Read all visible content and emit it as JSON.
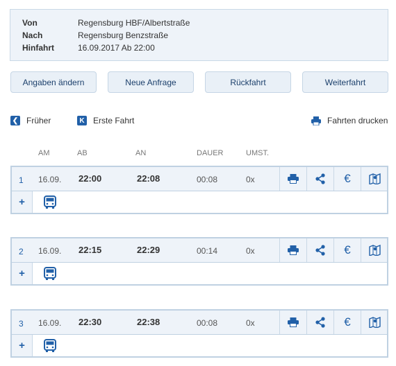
{
  "summary": {
    "von_label": "Von",
    "von_value": "Regensburg HBF/Albertstraße",
    "nach_label": "Nach",
    "nach_value": "Regensburg Benzstraße",
    "hinfahrt_label": "Hinfahrt",
    "hinfahrt_value": "16.09.2017 Ab 22:00"
  },
  "buttons": {
    "edit": "Angaben ändern",
    "new": "Neue Anfrage",
    "return": "Rückfahrt",
    "onward": "Weiterfahrt"
  },
  "nav": {
    "earlier": "Früher",
    "first": "Erste Fahrt",
    "print_all": "Fahrten drucken"
  },
  "columns": {
    "am": "AM",
    "ab": "AB",
    "an": "AN",
    "dauer": "DAUER",
    "umst": "UMST."
  },
  "trips": [
    {
      "num": "1",
      "date": "16.09.",
      "dep": "22:00",
      "arr": "22:08",
      "duration": "00:08",
      "changes": "0x"
    },
    {
      "num": "2",
      "date": "16.09.",
      "dep": "22:15",
      "arr": "22:29",
      "duration": "00:14",
      "changes": "0x"
    },
    {
      "num": "3",
      "date": "16.09.",
      "dep": "22:30",
      "arr": "22:38",
      "duration": "00:08",
      "changes": "0x"
    }
  ],
  "icons": {
    "print": "printer-icon",
    "share": "share-icon",
    "price": "euro-icon",
    "map": "map-icon",
    "bus": "bus-icon",
    "expand": "plus-icon",
    "earlier": "chevron-left-icon",
    "first": "skip-first-icon"
  },
  "colors": {
    "accent": "#2160a8",
    "panel": "#eef3f9",
    "border": "#bfd1e2"
  }
}
